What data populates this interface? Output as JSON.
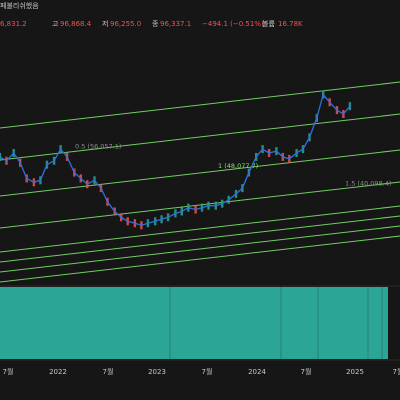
{
  "header": {
    "title_suffix": "페불리쉬했음",
    "open_value": "6,831.2",
    "high_label": "고",
    "high_value": "96,868.4",
    "low_label": "저",
    "low_value": "96,255.0",
    "close_label": "종",
    "close_value": "96,337.1",
    "change_value": "−494.1 (−0.51%)",
    "volume_label": "볼륨",
    "volume_value": "16.78K"
  },
  "colors": {
    "background": "#161616",
    "price_line": "#2f6fe0",
    "candle_up": "#26a69a",
    "candle_down": "#ef5350",
    "channel": "#6fce62",
    "fib_label": "#8e8e8e",
    "fib_label_bright": "#8be07a",
    "volume_fill": "#2aa596",
    "up_text": "#ef5350",
    "down_text": "#4d8dff"
  },
  "chart_data": {
    "type": "line",
    "title": "",
    "xlabel": "",
    "ylabel": "",
    "x_tick_labels": [
      "7월",
      "2022",
      "7월",
      "2023",
      "7월",
      "2024",
      "7월",
      "2025",
      "7월"
    ],
    "channel_levels": [
      {
        "label": "",
        "price": null
      },
      {
        "label": "0.5 (56,057.1)",
        "price": 56057.1
      },
      {
        "label": "1 (48,077.7)",
        "price": 48077.7
      },
      {
        "label": "1.5 (40,098.4)",
        "price": 40098.4
      },
      {
        "label": "",
        "price": null
      },
      {
        "label": "",
        "price": null
      },
      {
        "label": "",
        "price": null
      },
      {
        "label": "",
        "price": null
      }
    ],
    "series": [
      {
        "values_relative_scale": true,
        "x": [
          2021.0,
          2021.08,
          2021.17,
          2021.25,
          2021.33,
          2021.42,
          2021.5,
          2021.58,
          2021.67,
          2021.75,
          2021.83,
          2021.92,
          2022.0,
          2022.08,
          2022.17,
          2022.25,
          2022.33,
          2022.42,
          2022.5,
          2022.58,
          2022.67,
          2022.75,
          2022.83,
          2022.92,
          2023.0,
          2023.08,
          2023.17,
          2023.25,
          2023.33,
          2023.42,
          2023.5,
          2023.58,
          2023.67,
          2023.75,
          2023.83,
          2023.92,
          2024.0,
          2024.08,
          2024.17,
          2024.25,
          2024.33,
          2024.42,
          2024.5,
          2024.58,
          2024.67,
          2024.75,
          2024.83,
          2024.92,
          2025.0,
          2025.08,
          2025.17,
          2025.25,
          2025.33
        ],
        "y": [
          58,
          56,
          60,
          55,
          47,
          45,
          46,
          54,
          56,
          62,
          58,
          50,
          47,
          44,
          46,
          42,
          35,
          30,
          27,
          25,
          24,
          23,
          24,
          25,
          26,
          27,
          29,
          30,
          32,
          31,
          32,
          33,
          33,
          34,
          36,
          39,
          42,
          50,
          58,
          62,
          60,
          61,
          58,
          57,
          60,
          62,
          68,
          78,
          90,
          86,
          82,
          80,
          84
        ]
      }
    ],
    "volume_levels": "high"
  }
}
